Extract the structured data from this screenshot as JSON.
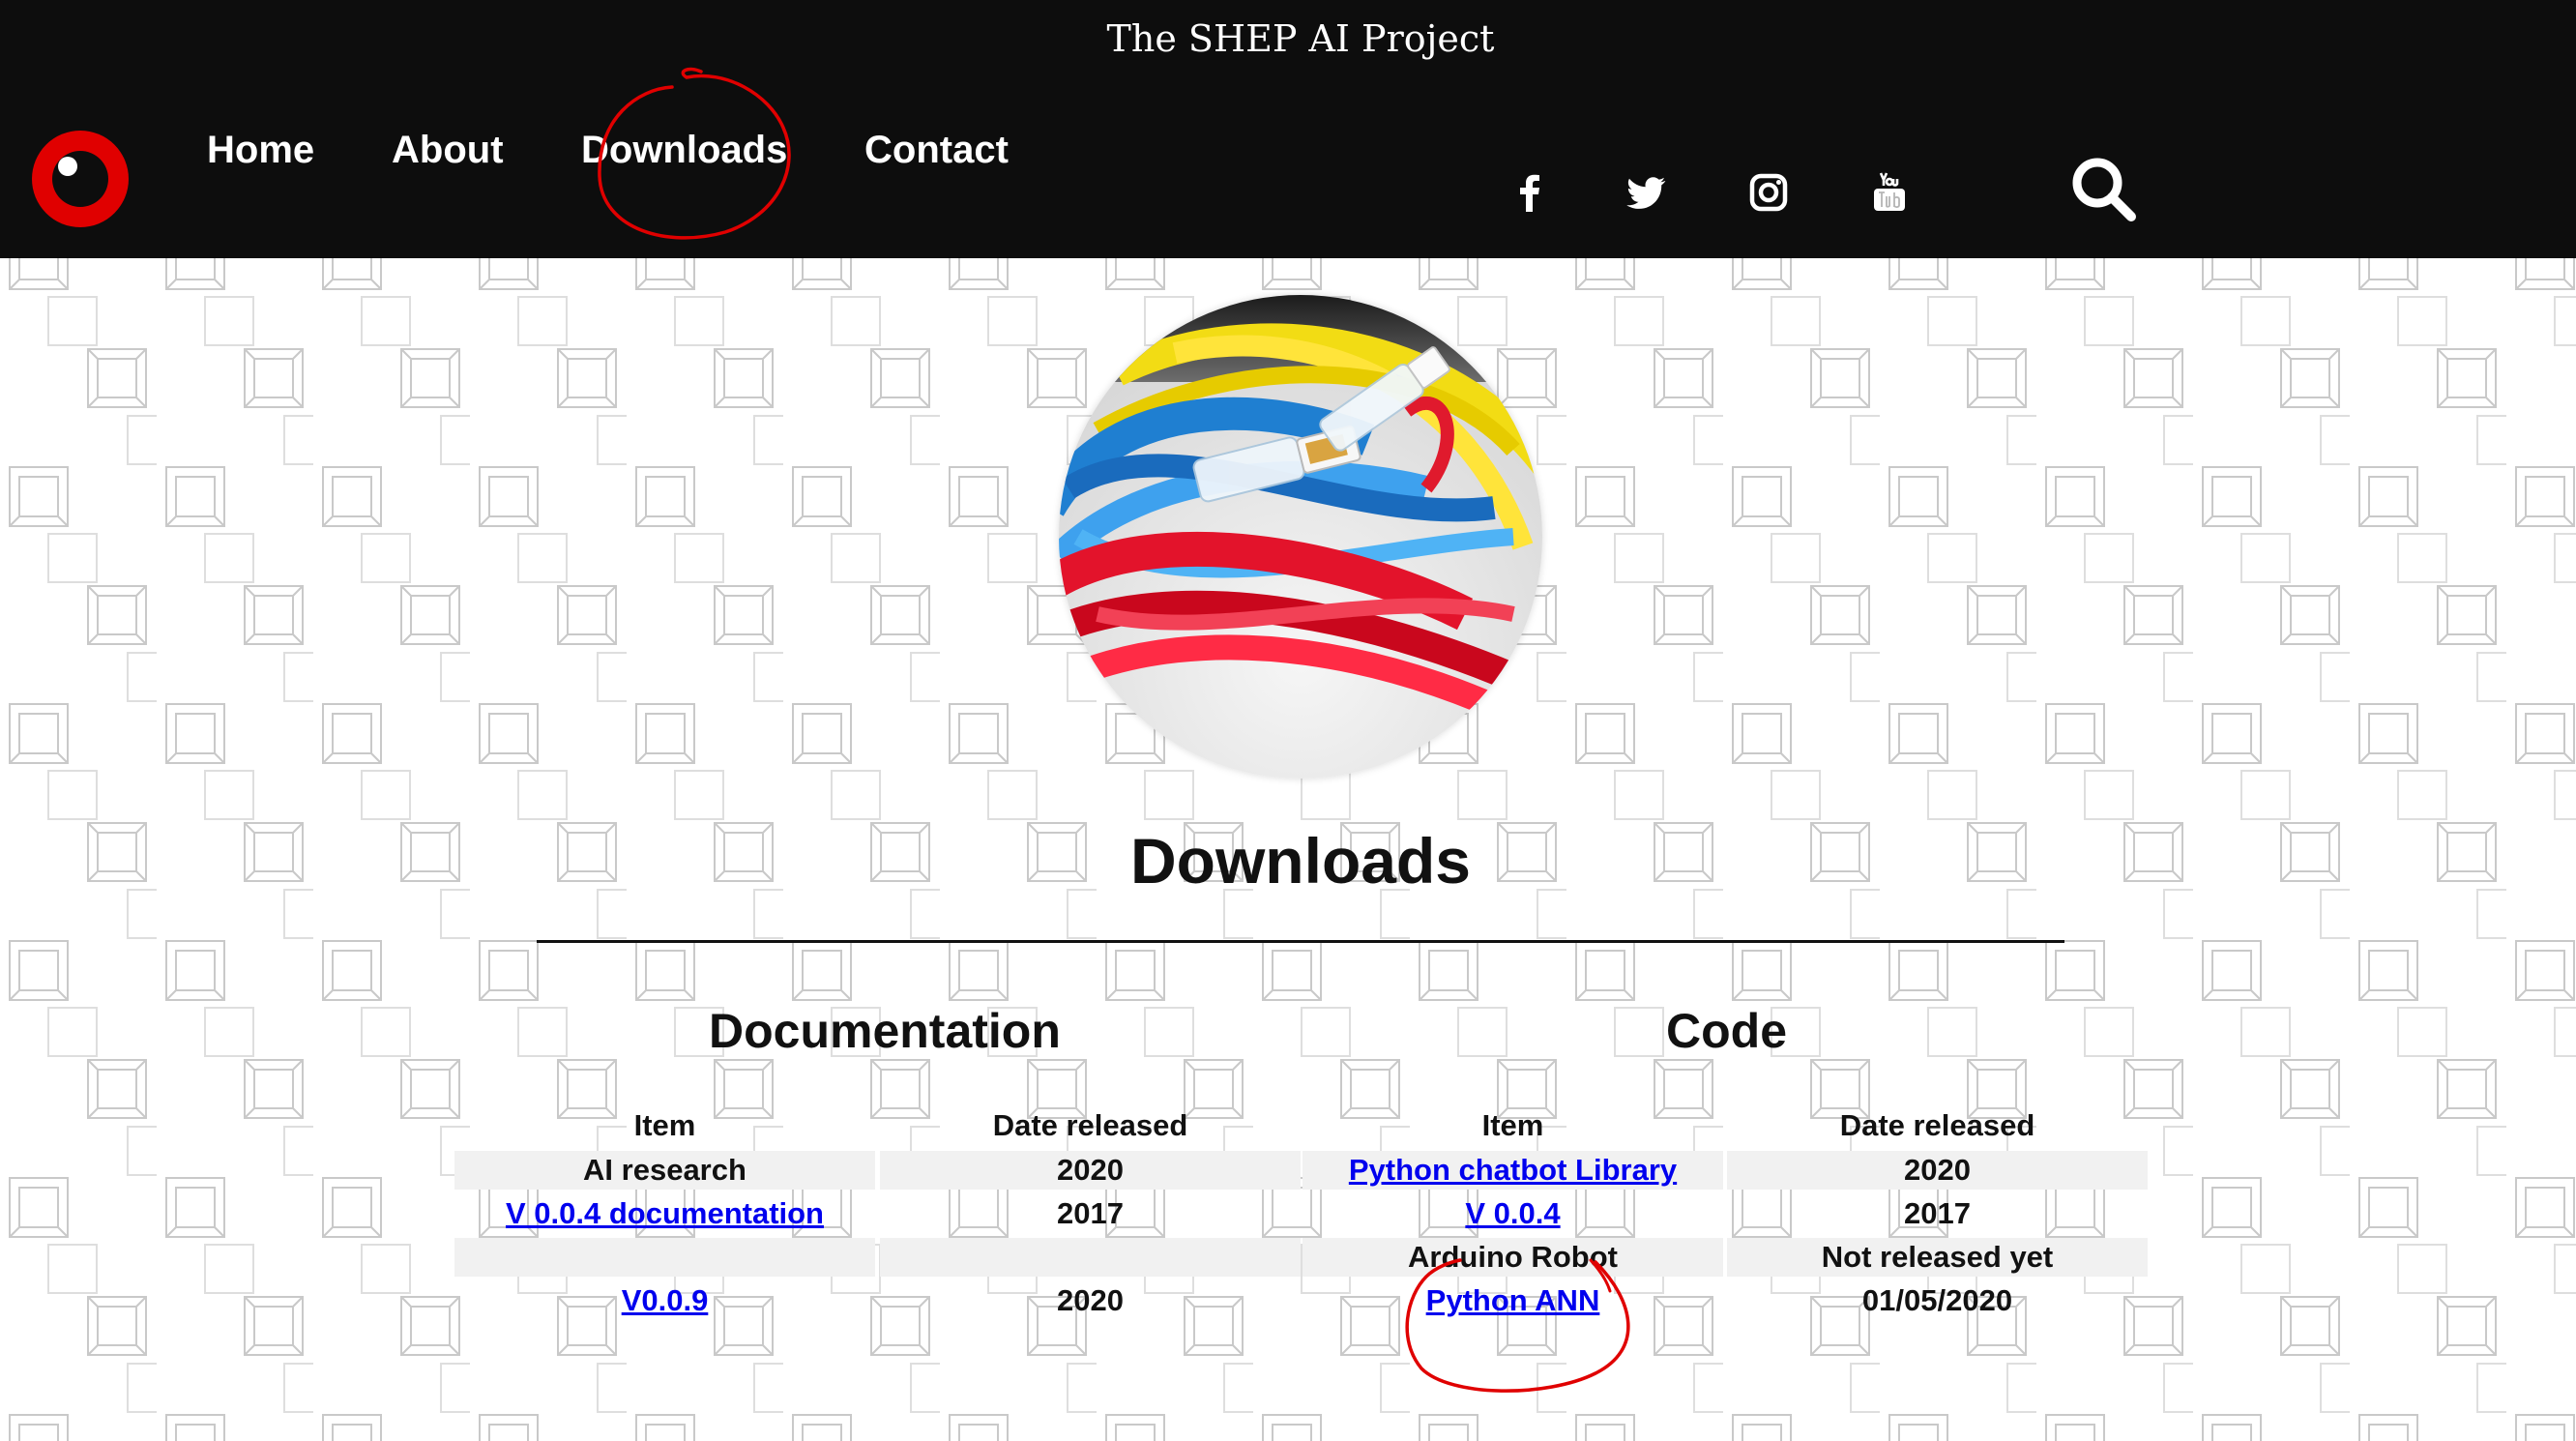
{
  "site": {
    "title": "The SHEP AI Project"
  },
  "nav": {
    "items": [
      {
        "label": "Home"
      },
      {
        "label": "About"
      },
      {
        "label": "Downloads"
      },
      {
        "label": "Contact"
      }
    ]
  },
  "social": [
    "facebook-icon",
    "twitter-icon",
    "instagram-icon",
    "youtube-icon"
  ],
  "page": {
    "title": "Downloads"
  },
  "documentation": {
    "title": "Documentation",
    "headers": [
      "Item",
      "Date released"
    ],
    "rows": [
      {
        "item": "AI research",
        "date": "2020",
        "link": false
      },
      {
        "item": "V 0.0.4 documentation",
        "date": "2017",
        "link": true
      },
      {
        "item": "",
        "date": "",
        "link": false
      },
      {
        "item": "V0.0.9",
        "date": "2020",
        "link": true
      }
    ]
  },
  "code": {
    "title": "Code",
    "headers": [
      "Item",
      "Date released"
    ],
    "rows": [
      {
        "item": "Python chatbot Library",
        "date": "2020",
        "link": true
      },
      {
        "item": "V 0.0.4",
        "date": "2017",
        "link": true
      },
      {
        "item": "Arduino Robot",
        "date": "Not released yet",
        "link": false
      },
      {
        "item": "Python ANN",
        "date": "01/05/2020",
        "link": true
      }
    ]
  },
  "colors": {
    "header_bg": "#0d0d0d",
    "accent": "#e00000",
    "link": "#0000ee",
    "annotation": "#e00000"
  }
}
